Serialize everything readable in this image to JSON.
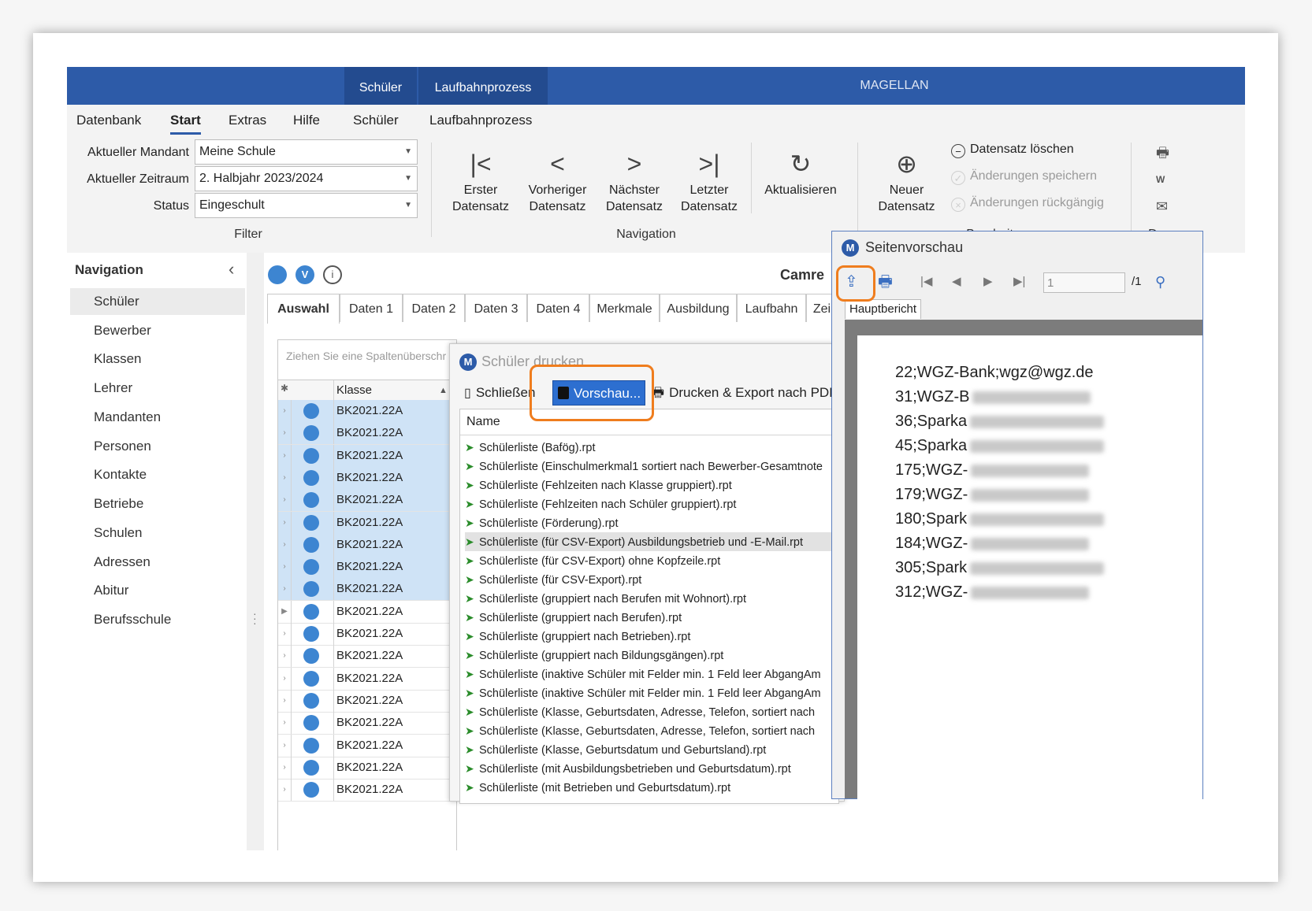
{
  "title_bar": {
    "context_tabs": [
      "Schüler",
      "Laufbahnprozess"
    ],
    "app_title": "MAGELLAN"
  },
  "menu": [
    "Datenbank",
    "Start",
    "Extras",
    "Hilfe",
    "Schüler",
    "Laufbahnprozess"
  ],
  "filter": {
    "mandant_label": "Aktueller Mandant",
    "mandant_value": "Meine Schule",
    "zeitraum_label": "Aktueller Zeitraum",
    "zeitraum_value": "2. Halbjahr 2023/2024",
    "status_label": "Status",
    "status_value": "Eingeschult",
    "group_label": "Filter"
  },
  "navigation_group": {
    "buttons": [
      {
        "line1": "Erster",
        "line2": "Datensatz"
      },
      {
        "line1": "Vorheriger",
        "line2": "Datensatz"
      },
      {
        "line1": "Nächster",
        "line2": "Datensatz"
      },
      {
        "line1": "Letzter",
        "line2": "Datensatz"
      }
    ],
    "refresh": "Aktualisieren",
    "group_label": "Navigation"
  },
  "edit_group": {
    "new_line1": "Neuer",
    "new_line2": "Datensatz",
    "delete": "Datensatz löschen",
    "save": "Änderungen speichern",
    "undo": "Änderungen rückgängig",
    "group_label": "Bearbeiten",
    "print_label_partial": "Dru"
  },
  "sidebar": {
    "title": "Navigation",
    "items": [
      "Schüler",
      "Bewerber",
      "Klassen",
      "Lehrer",
      "Mandanten",
      "Personen",
      "Kontakte",
      "Betriebe",
      "Schulen",
      "Adressen",
      "Abitur",
      "Berufsschule"
    ]
  },
  "main": {
    "record_name_partial": "Camre",
    "tabs": [
      "Auswahl",
      "Daten 1",
      "Daten 2",
      "Daten 3",
      "Daten 4",
      "Merkmale",
      "Ausbildung",
      "Laufbahn",
      "Zei"
    ],
    "grid_hint": "Ziehen Sie eine Spaltenüberschr",
    "grid_column": "Klasse",
    "grid_rows": [
      "BK2021.22A",
      "BK2021.22A",
      "BK2021.22A",
      "BK2021.22A",
      "BK2021.22A",
      "BK2021.22A",
      "BK2021.22A",
      "BK2021.22A",
      "BK2021.22A",
      "BK2021.22A",
      "BK2021.22A",
      "BK2021.22A",
      "BK2021.22A",
      "BK2021.22A",
      "BK2021.22A",
      "BK2021.22A",
      "BK2021.22A",
      "BK2021.22A"
    ]
  },
  "print_dialog": {
    "title": "Schüler drucken",
    "close": "Schließen",
    "preview": "Vorschau...",
    "print_export": "Drucken & Export nach PDF",
    "column_name": "Name",
    "reports": [
      "Schülerliste (Bafög).rpt",
      "Schülerliste (Einschulmerkmal1 sortiert nach Bewerber-Gesamtnote",
      "Schülerliste (Fehlzeiten nach Klasse gruppiert).rpt",
      "Schülerliste (Fehlzeiten nach Schüler gruppiert).rpt",
      "Schülerliste (Förderung).rpt",
      "Schülerliste (für CSV-Export) Ausbildungsbetrieb und -E-Mail.rpt",
      "Schülerliste (für CSV-Export) ohne Kopfzeile.rpt",
      "Schülerliste (für CSV-Export).rpt",
      "Schülerliste (gruppiert nach Berufen mit Wohnort).rpt",
      "Schülerliste (gruppiert nach Berufen).rpt",
      "Schülerliste (gruppiert nach Betrieben).rpt",
      "Schülerliste (gruppiert nach Bildungsgängen).rpt",
      "Schülerliste (inaktive Schüler mit Felder min. 1 Feld leer AbgangAm",
      "Schülerliste (inaktive Schüler mit Felder min. 1 Feld leer AbgangAm",
      "Schülerliste (Klasse, Geburtsdaten, Adresse, Telefon, sortiert nach",
      "Schülerliste (Klasse, Geburtsdaten, Adresse, Telefon, sortiert nach",
      "Schülerliste (Klasse, Geburtsdatum und Geburtsland).rpt",
      "Schülerliste (mit Ausbildungsbetrieben und Geburtsdatum).rpt",
      "Schülerliste (mit Betrieben und Geburtsdatum).rpt"
    ]
  },
  "preview_window": {
    "title": "Seitenvorschau",
    "page_input": "1",
    "page_total": "/1",
    "report_tab": "Hauptbericht",
    "lines": [
      "22;WGZ-Bank;wgz@wgz.de",
      "31;WGZ-B",
      "36;Sparka",
      "45;Sparka",
      "175;WGZ-",
      "179;WGZ-",
      "180;Spark",
      "184;WGZ-",
      "305;Spark",
      "312;WGZ-"
    ]
  },
  "colors": {
    "title_bar": "#2d5ba8",
    "highlight": "#ef7d1e",
    "selection": "#cfe3f6",
    "status_dot": "#3d85d1"
  }
}
